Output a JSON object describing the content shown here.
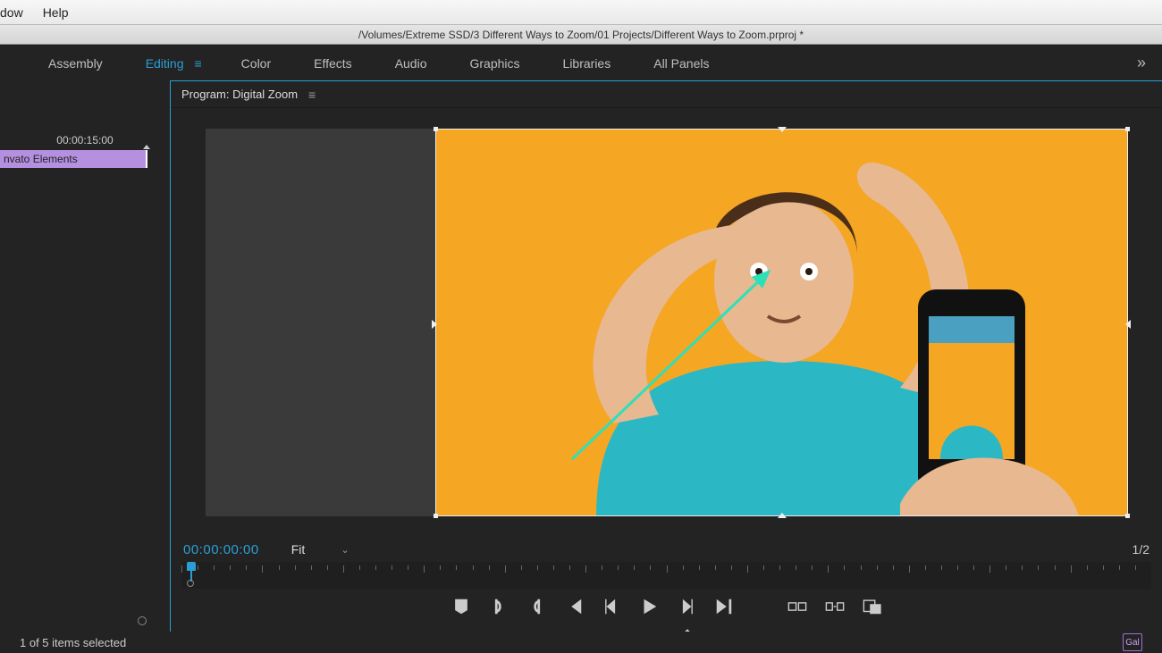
{
  "menubar": {
    "items": [
      "dow",
      "Help"
    ]
  },
  "titlebar": {
    "path": "/Volumes/Extreme SSD/3 Different Ways to Zoom/01 Projects/Different Ways to Zoom.prproj *"
  },
  "workspaces": {
    "items": [
      "Assembly",
      "Editing",
      "Color",
      "Effects",
      "Audio",
      "Graphics",
      "Libraries",
      "All Panels"
    ],
    "active_index": 1
  },
  "left_panel": {
    "ruler_time": "00:00:15:00",
    "clip_label": "nvato Elements"
  },
  "program_panel": {
    "tab_label": "Program: Digital Zoom",
    "current_timecode": "00:00:00:00",
    "zoom_label": "Fit",
    "duration_fraction": "1/2"
  },
  "statusbar": {
    "selection_text": "1 of 5 items selected",
    "badge": "Gal"
  },
  "icons": {
    "filter": "filter-icon",
    "new_item": "new-item-icon",
    "export": "export-icon"
  }
}
